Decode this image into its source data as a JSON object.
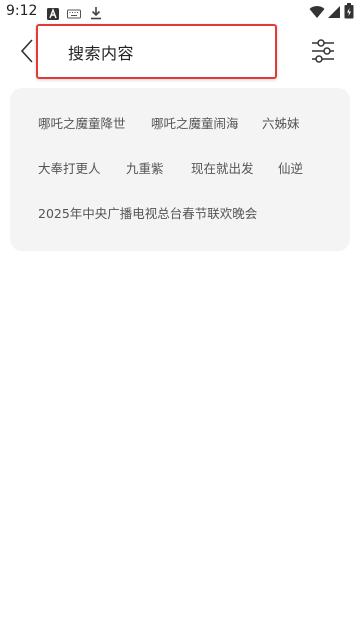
{
  "status_bar": {
    "time": "9:12",
    "left_icons": [
      "font-icon",
      "keyboard-icon",
      "download-icon"
    ],
    "right_icons": [
      "wifi-icon",
      "signal-icon",
      "battery-icon"
    ]
  },
  "header": {
    "search": {
      "value": "搜索内容",
      "highlight_color": "#e53935"
    },
    "back_icon": "chevron-left-icon",
    "filter_icon": "sliders-icon"
  },
  "history": {
    "items": [
      "哪吒之魔童降世",
      "哪吒之魔童闹海",
      "六姊妹",
      "大奉打更人",
      "九重紫",
      "现在就出发",
      "仙逆",
      "2025年中央广播电视总台春节联欢晚会"
    ]
  }
}
